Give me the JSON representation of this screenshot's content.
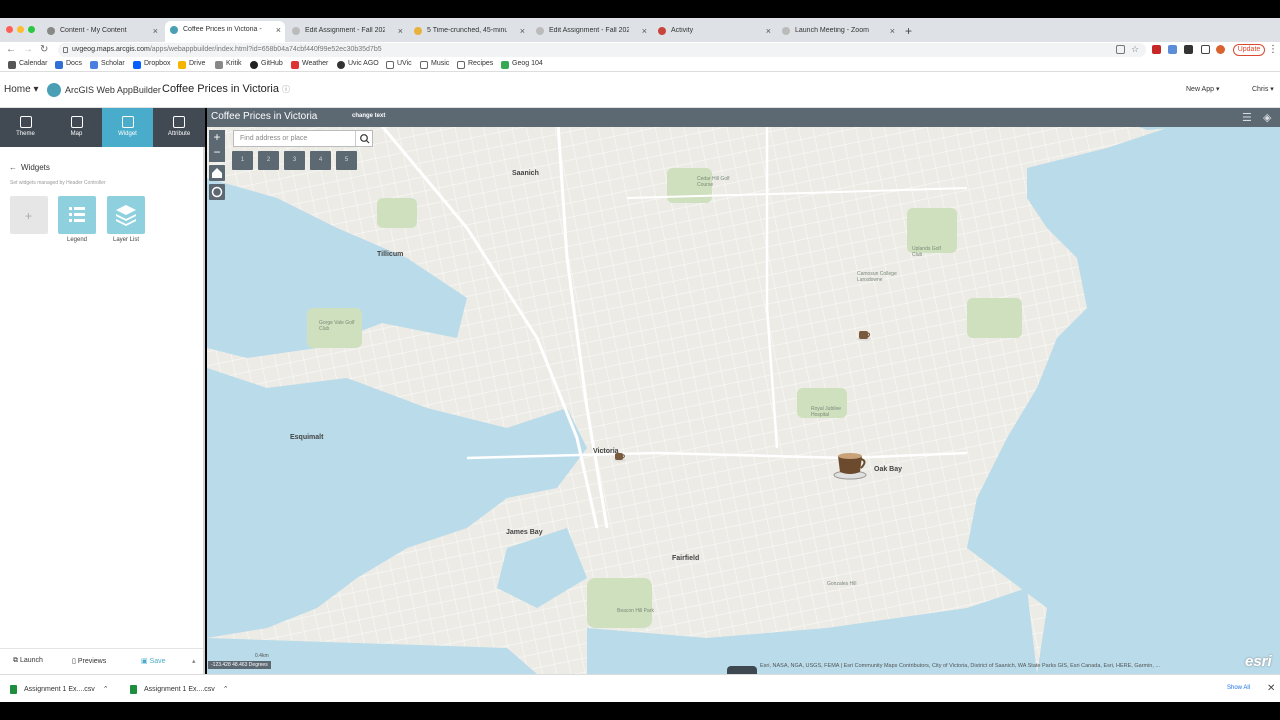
{
  "browser": {
    "tabs": [
      {
        "label": "Content - My Content",
        "active": false
      },
      {
        "label": "Coffee Prices in Victoria - ArcG",
        "active": true
      },
      {
        "label": "Edit Assignment - Fall 2022 G",
        "active": false
      },
      {
        "label": "5 Time-crunched, 45-minute",
        "active": false
      },
      {
        "label": "Edit Assignment - Fall 2022 G",
        "active": false
      },
      {
        "label": "Activity",
        "active": false
      },
      {
        "label": "Launch Meeting - Zoom",
        "active": false
      }
    ],
    "url_host": "uvgeog.maps.arcgis.com",
    "url_path": "/apps/webappbuilder/index.html?id=658b04a74cbf440f99e52ec30b35d7b5",
    "update_label": "Update",
    "bookmarks": [
      "Calendar",
      "Docs",
      "Scholar",
      "Dropbox",
      "Drive",
      "Kritik",
      "GitHub",
      "Weather",
      "Uvic AGO",
      "UVic",
      "Music",
      "Recipes",
      "Geog 104"
    ]
  },
  "app_header": {
    "home": "Home",
    "product": "ArcGIS Web AppBuilder",
    "title": "Coffee Prices in Victoria",
    "new_app": "New App",
    "user": "Chris"
  },
  "left_panel": {
    "nav_tabs": [
      "Theme",
      "Map",
      "Widget",
      "Attribute"
    ],
    "selected_tab": "Widget",
    "section_title": "Widgets",
    "note": "Set widgets managed by Header Controller",
    "widgets": [
      "Legend",
      "Layer List"
    ],
    "footer": {
      "launch": "Launch",
      "previews": "Previews",
      "save": "Save"
    }
  },
  "map": {
    "title": "Coffee Prices in Victoria",
    "change_text": "change text",
    "search_placeholder": "Find address or place",
    "widget_slots": [
      "1",
      "2",
      "3",
      "4",
      "5"
    ],
    "places_major": [
      "Saanich",
      "Tillicum",
      "Esquimalt",
      "Victoria",
      "Oak Bay",
      "James Bay",
      "Fairfield"
    ],
    "places_minor": [
      "Cedar Hill Golf Course",
      "Uplands Golf Club",
      "Gorge Vale Golf Club",
      "Royal Jubilee Hospital",
      "Beacon Hill Park",
      "Camosun College Lansdowne",
      "Gonzales Hill"
    ],
    "coordinates": "-123.428 48.463 Degrees",
    "scale": "0.4km",
    "attribution": "Esri, NASA, NGA, USGS, FEMA | Esri Community Maps Contributors, City of Victoria, District of Saanich, WA State Parks GIS, Esri Canada, Esri, HERE, Garmin, ...",
    "logo": "esri"
  },
  "downloads": {
    "files": [
      "Assignment 1 Ex....csv",
      "Assignment 1 Ex....csv"
    ],
    "show_all": "Show All"
  },
  "colors": {
    "accent": "#4aaccb",
    "nav_bg": "#414a52",
    "map_bar": "#5c6872",
    "water": "#b9dbea",
    "park": "#cfe0be"
  }
}
